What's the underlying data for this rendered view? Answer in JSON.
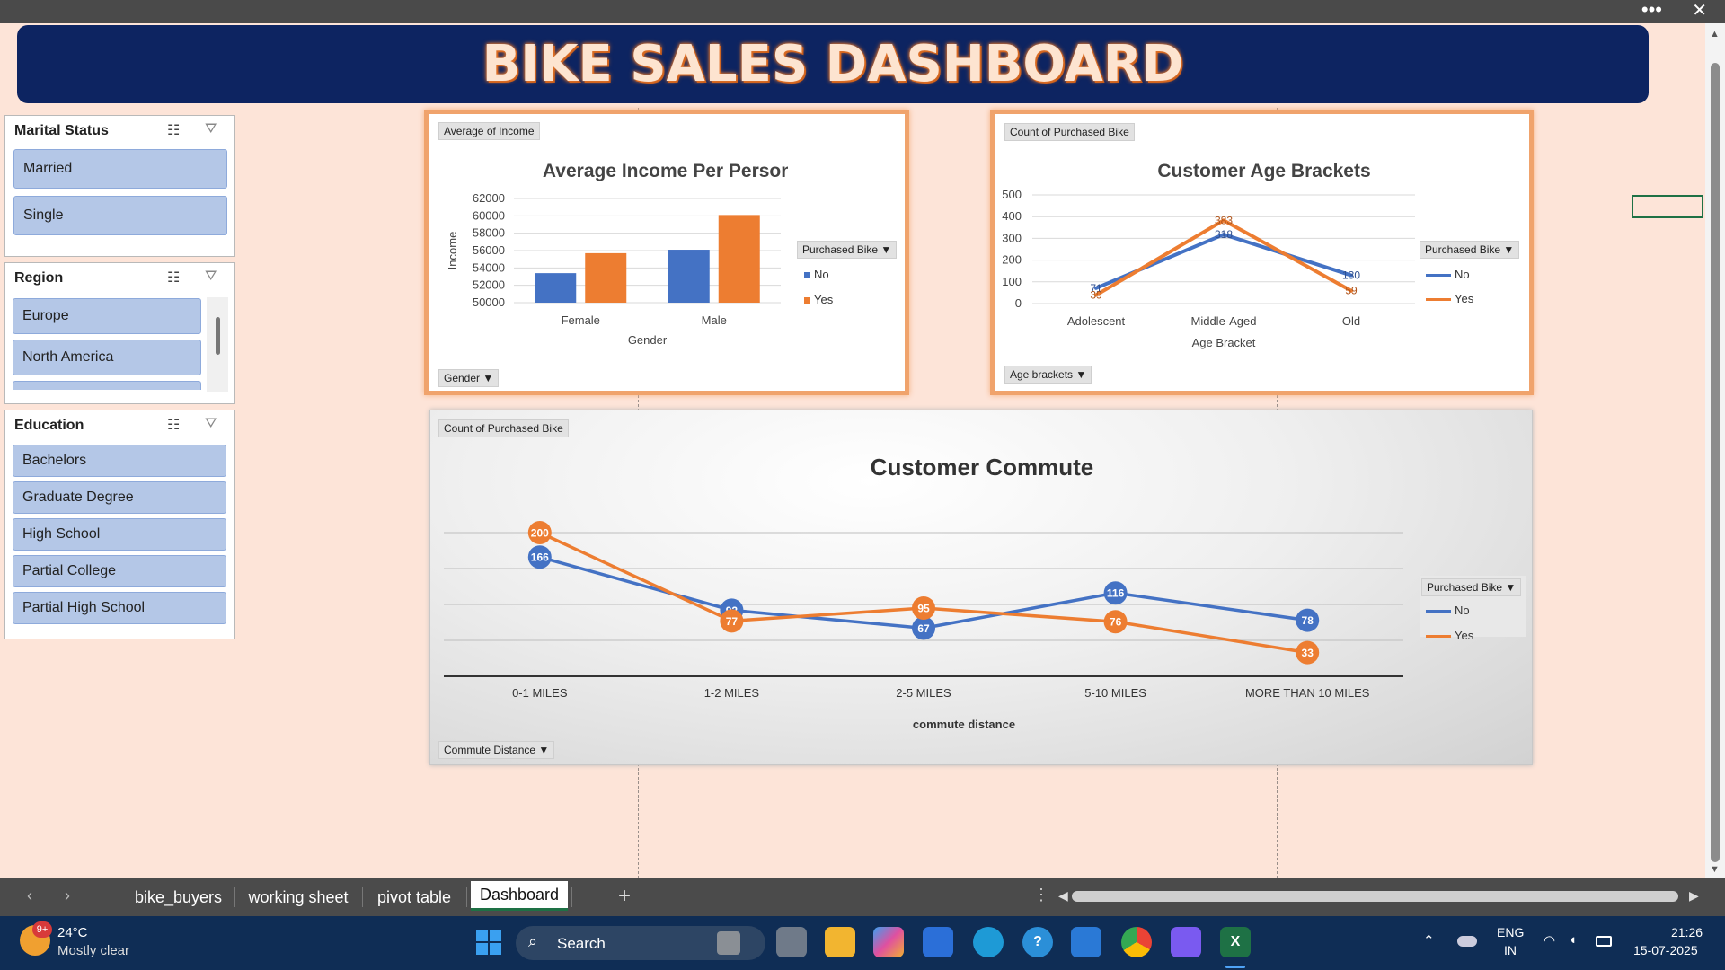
{
  "dashboard": {
    "title": "BIKE SALES DASHBOARD"
  },
  "slicers": {
    "marital": {
      "title": "Marital Status",
      "items": [
        "Married",
        "Single"
      ]
    },
    "region": {
      "title": "Region",
      "items": [
        "Europe",
        "North America"
      ]
    },
    "education": {
      "title": "Education",
      "items": [
        "Bachelors",
        "Graduate Degree",
        "High School",
        "Partial College",
        "Partial High School"
      ]
    }
  },
  "income_chart": {
    "value_button": "Average of Income",
    "axis_button": "Gender",
    "legend_button": "Purchased Bike",
    "legend_items": [
      "No",
      "Yes"
    ]
  },
  "age_chart": {
    "value_button": "Count of Purchased Bike",
    "axis_button": "Age brackets",
    "legend_button": "Purchased Bike",
    "legend_items": [
      "No",
      "Yes"
    ]
  },
  "commute_chart": {
    "value_button": "Count of Purchased Bike",
    "axis_button": "Commute Distance",
    "legend_button": "Purchased Bike",
    "legend_items": [
      "No",
      "Yes"
    ]
  },
  "colors": {
    "no": "#4472c4",
    "yes": "#ed7d31",
    "banner": "#0d2461",
    "panel_border": "#f0a36c"
  },
  "chart_data": [
    {
      "type": "bar",
      "title": "Average Income Per Person",
      "xlabel": "Gender",
      "ylabel": "Income",
      "categories": [
        "Female",
        "Male"
      ],
      "series": [
        {
          "name": "No",
          "values": [
            53400,
            56100
          ]
        },
        {
          "name": "Yes",
          "values": [
            55700,
            60100
          ]
        }
      ],
      "ylim": [
        50000,
        62000
      ],
      "yticks": [
        "50000",
        "52000",
        "54000",
        "56000",
        "58000",
        "60000",
        "62000"
      ],
      "grid": true,
      "legend": "right"
    },
    {
      "type": "line",
      "title": "Customer Age Brackets",
      "xlabel": "Age Bracket",
      "ylabel": "",
      "categories": [
        "Adolescent",
        "Middle-Aged",
        "Old"
      ],
      "series": [
        {
          "name": "No",
          "values": [
            71,
            318,
            130
          ]
        },
        {
          "name": "Yes",
          "values": [
            39,
            383,
            59
          ]
        }
      ],
      "ylim": [
        0,
        500
      ],
      "yticks": [
        "0",
        "100",
        "200",
        "300",
        "400",
        "500"
      ],
      "grid": true,
      "legend": "right"
    },
    {
      "type": "line",
      "title": "Customer Commute",
      "xlabel": "commute distance",
      "ylabel": "",
      "categories": [
        "0-1 MILES",
        "1-2 MILES",
        "2-5 MILES",
        "5-10 MILES",
        "MORE THAN 10 MILES"
      ],
      "series": [
        {
          "name": "No",
          "values": [
            166,
            92,
            67,
            116,
            78
          ]
        },
        {
          "name": "Yes",
          "values": [
            200,
            77,
            95,
            76,
            33
          ]
        }
      ],
      "ylim": [
        0,
        250
      ],
      "grid": true,
      "legend": "right"
    }
  ],
  "sheet_tabs": {
    "items": [
      "bike_buyers",
      "working sheet",
      "pivot table",
      "Dashboard"
    ],
    "active": "Dashboard"
  },
  "taskbar": {
    "weather_temp": "24°C",
    "weather_desc": "Mostly clear",
    "weather_badge": "9+",
    "search_placeholder": "Search",
    "lang_line1": "ENG",
    "lang_line2": "IN",
    "time": "21:26",
    "date": "15-07-2025"
  }
}
